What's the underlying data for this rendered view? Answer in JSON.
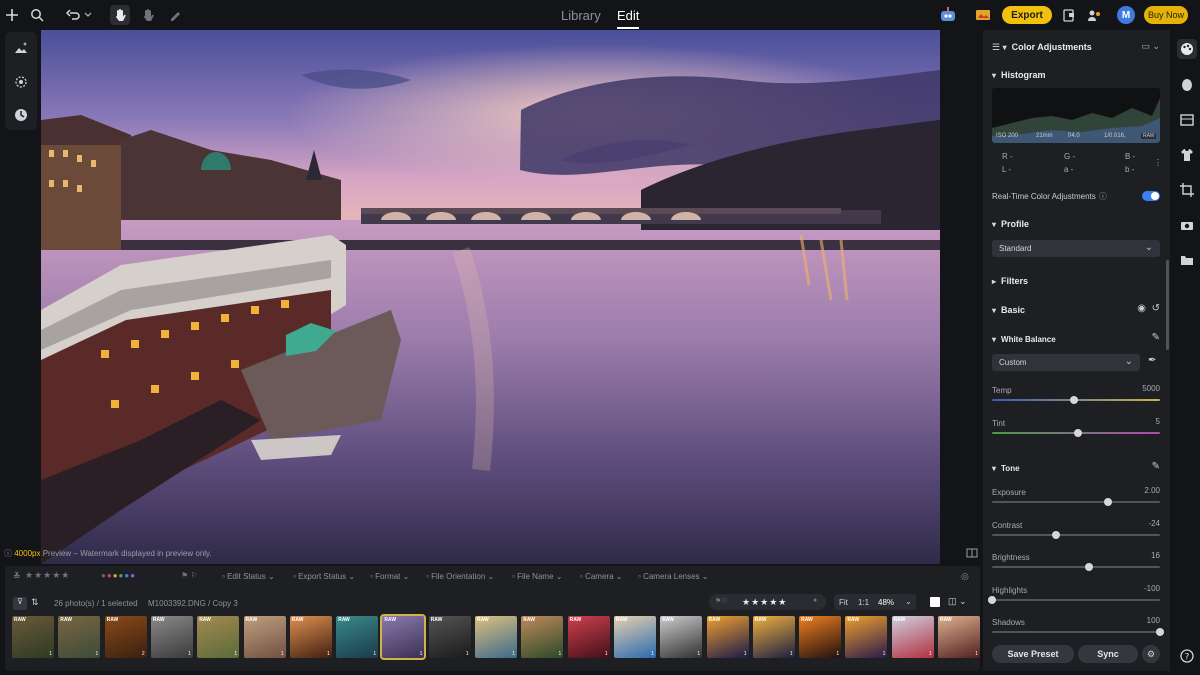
{
  "app": {
    "tabs": [
      {
        "label": "Library"
      },
      {
        "label": "Edit"
      }
    ],
    "export_label": "Export",
    "buy_label": "Buy Now",
    "avatar_initial": "M"
  },
  "preview_note": {
    "size": "4000px",
    "text": "Preview – Watermark displayed in preview only."
  },
  "panel": {
    "title": "Color Adjustments",
    "histogram": {
      "label": "Histogram",
      "iso": "ISO 200",
      "focal": "21mm",
      "aperture": "f/4.0",
      "shutter": "1/0.016,",
      "format": "RAW",
      "r1": "R -",
      "g1": "G -",
      "b1": "B -",
      "l1": "L -",
      "a1": "a -",
      "b2": "b -"
    },
    "realtime_label": "Real-Time Color Adjustments",
    "profile": {
      "label": "Profile",
      "value": "Standard"
    },
    "filters_label": "Filters",
    "basic_label": "Basic",
    "white_balance": {
      "label": "White Balance",
      "value": "Custom"
    },
    "sliders_wb": [
      {
        "name": "Temp",
        "value": "5000",
        "pos": 0.49
      },
      {
        "name": "Tint",
        "value": "5",
        "pos": 0.51
      }
    ],
    "tone_label": "Tone",
    "sliders_tone": [
      {
        "name": "Exposure",
        "value": "2.00",
        "pos": 0.69
      },
      {
        "name": "Contrast",
        "value": "-24",
        "pos": 0.38
      },
      {
        "name": "Brightness",
        "value": "16",
        "pos": 0.58
      },
      {
        "name": "Highlights",
        "value": "-100",
        "pos": 0.0
      },
      {
        "name": "Shadows",
        "value": "100",
        "pos": 1.0
      }
    ],
    "save_preset_label": "Save Preset",
    "sync_label": "Sync"
  },
  "filmstrip": {
    "filters": [
      "Edit Status",
      "Export Status",
      "Format",
      "File Orientation",
      "File Name",
      "Camera",
      "Camera Lenses"
    ],
    "count_text": "26 photo(s) / 1 selected",
    "file_text": "M1003392.DNG / Copy 3",
    "fit_label": "Fit",
    "one_label": "1:1",
    "zoom": "48%",
    "thumbs": [
      {
        "raw": "RAW",
        "cnt": "1",
        "c1": "#6b5a3a",
        "c2": "#2d3a22"
      },
      {
        "raw": "RAW",
        "cnt": "1",
        "c1": "#7a6640",
        "c2": "#3c4a3a"
      },
      {
        "raw": "RAW",
        "cnt": "2",
        "c1": "#8a4a1a",
        "c2": "#3a2010"
      },
      {
        "raw": "RAW",
        "cnt": "1",
        "c1": "#8a8a8a",
        "c2": "#3a3a3a"
      },
      {
        "raw": "RAW",
        "cnt": "1",
        "c1": "#a48a50",
        "c2": "#5a6a3a"
      },
      {
        "raw": "RAW",
        "cnt": "1",
        "c1": "#c0a080",
        "c2": "#705040"
      },
      {
        "raw": "RAW",
        "cnt": "1",
        "c1": "#e09050",
        "c2": "#402010"
      },
      {
        "raw": "RAW",
        "cnt": "1",
        "c1": "#3a8a8a",
        "c2": "#1a3a4a"
      },
      {
        "raw": "RAW",
        "cnt": "1",
        "c1": "#8a7ab0",
        "c2": "#3a3050"
      },
      {
        "raw": "RAW",
        "cnt": "1",
        "c1": "#555555",
        "c2": "#1a1a1a"
      },
      {
        "raw": "RAW",
        "cnt": "1",
        "c1": "#e0c080",
        "c2": "#3a6a8a"
      },
      {
        "raw": "RAW",
        "cnt": "1",
        "c1": "#c08a5a",
        "c2": "#2a4a2a"
      },
      {
        "raw": "RAW",
        "cnt": "1",
        "c1": "#d04050",
        "c2": "#401018"
      },
      {
        "raw": "RAW",
        "cnt": "1",
        "c1": "#e8d0b0",
        "c2": "#2a6ab0"
      },
      {
        "raw": "RAW",
        "cnt": "1",
        "c1": "#cccccc",
        "c2": "#303030"
      },
      {
        "raw": "RAW",
        "cnt": "1",
        "c1": "#f0a030",
        "c2": "#1a1a4a"
      },
      {
        "raw": "RAW",
        "cnt": "1",
        "c1": "#f0b040",
        "c2": "#1a2040"
      },
      {
        "raw": "RAW",
        "cnt": "1",
        "c1": "#f08020",
        "c2": "#201010"
      },
      {
        "raw": "RAW",
        "cnt": "1",
        "c1": "#f0a030",
        "c2": "#2a1a4a"
      },
      {
        "raw": "RAW",
        "cnt": "1",
        "c1": "#d0d0e0",
        "c2": "#b03040"
      },
      {
        "raw": "RAW",
        "cnt": "1",
        "c1": "#e0b090",
        "c2": "#502020"
      }
    ],
    "selected_index": 8
  }
}
